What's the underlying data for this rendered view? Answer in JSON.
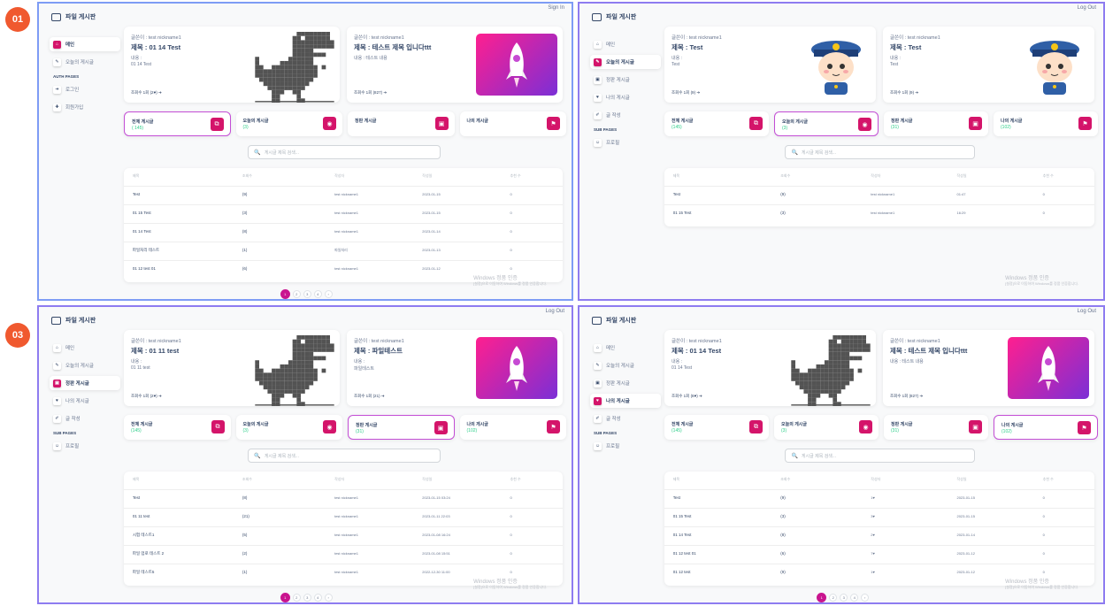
{
  "badges": [
    "01",
    "03"
  ],
  "app": {
    "brand": "파일 게시판"
  },
  "account": {
    "sign_in": "Sign In",
    "log_out": "Log Out"
  },
  "sidebar_guest": {
    "items": [
      "메인",
      "오늘의 게시글"
    ],
    "section": "AUTH PAGES",
    "auth_items": [
      "로그인",
      "회원가입"
    ]
  },
  "sidebar_user": {
    "items": [
      "메인",
      "오늘의 게시글",
      "정판 게시글",
      "나의 게시글",
      "글 작성"
    ],
    "section": "SUB PAGES",
    "profile": "프로필"
  },
  "panels": [
    {
      "left_post": {
        "author": "글쓴이 : test nickname1",
        "title": "제목 : 01 14 Test",
        "label": "내용 :",
        "content": "01 14 Test",
        "views": "조회수 1회 (2♥) ➔"
      },
      "right_post": {
        "author": "글쓴이 : test nickname1",
        "title": "제목 : 테스트 제목 입니다ttt",
        "label": "내용 : 테스트 내용",
        "content": "",
        "views": "조회수 1회 (827) ➔"
      },
      "stats": [
        {
          "label": "전체 게시글",
          "count": "( 145)"
        },
        {
          "label": "오늘의 게시글",
          "count": "(3)"
        },
        {
          "label": "정판 게시글",
          "count": ""
        },
        {
          "label": "나의 게시글",
          "count": ""
        }
      ],
      "search_placeholder": "게시글 제목 검색...",
      "headers": [
        "제목",
        "조회수",
        "작성자",
        "작성일",
        "추천 수"
      ],
      "rows": [
        [
          "Test",
          "(9)",
          "test nickname1",
          "2023-01-15",
          "0"
        ],
        [
          "01 15 Test",
          "(3)",
          "test nickname1",
          "2023-01-15",
          "0"
        ],
        [
          "01 14 Test",
          "(8)",
          "test nickname1",
          "2023-01-14",
          "0"
        ],
        [
          "파일처리 테스트",
          "(1)",
          "파일처리",
          "2023-01-13",
          "0"
        ],
        [
          "01 12 test 01",
          "(6)",
          "test nickname1",
          "2023-01-12",
          "0"
        ]
      ],
      "pages": [
        "1",
        "2",
        "3",
        "4",
        "›"
      ]
    },
    {
      "left_post": {
        "author": "글쓴이 : test nickname1",
        "title": "제목 : Test",
        "label": "내용 :",
        "content": "Test",
        "views": "조회수 1회 (9) ➔"
      },
      "right_post": {
        "author": "글쓴이 : test nickname1",
        "title": "제목 : Test",
        "label": "내용 :",
        "content": "Test",
        "views": "조회수 1회 (9) ➔"
      },
      "stats": [
        {
          "label": "전체 게시글",
          "count": "(145)"
        },
        {
          "label": "오늘의 게시글",
          "count": "(3)"
        },
        {
          "label": "정판 게시글",
          "count": "(31)"
        },
        {
          "label": "나의 게시글",
          "count": "(102)"
        }
      ],
      "search_placeholder": "게시글 제목 검색...",
      "headers": [
        "제목",
        "조회수",
        "작성자",
        "작성일",
        "추천 수"
      ],
      "rows": [
        [
          "Test",
          "(9)",
          "test nickname1",
          "01:47",
          "0"
        ],
        [
          "01 15 Test",
          "(3)",
          "test nickname1",
          "16:29",
          "0"
        ]
      ],
      "pages": []
    },
    {
      "left_post": {
        "author": "글쓴이 : test nickname1",
        "title": "제목 : 01 11 test",
        "label": "내용 :",
        "content": "01 11 test",
        "views": "조회수 1회 (2♥) ➔"
      },
      "right_post": {
        "author": "글쓴이 : test nickname1",
        "title": "제목 : 파일테스트",
        "label": "내용 :",
        "content": "파일테스트",
        "views": "조회수 1회 (21) ➔"
      },
      "stats": [
        {
          "label": "전체 게시글",
          "count": "(145)"
        },
        {
          "label": "오늘의 게시글",
          "count": "(3)"
        },
        {
          "label": "정판 게시글",
          "count": "(31)"
        },
        {
          "label": "나의 게시글",
          "count": "(102)"
        }
      ],
      "search_placeholder": "게시글 제목 검색...",
      "headers": [
        "제목",
        "조회수",
        "작성자",
        "작성일",
        "추천 수"
      ],
      "rows": [
        [
          "Test",
          "(8)",
          "test nickname1",
          "2023-01-15 03:24",
          "0"
        ],
        [
          "01 11 test",
          "(21)",
          "test nickname1",
          "2023-01-11 22:03",
          "0"
        ],
        [
          "시험 테스트1",
          "(5)",
          "test nickname1",
          "2023-01-08 16:24",
          "0"
        ],
        [
          "파일 업로 테스트 2",
          "(2)",
          "test nickname1",
          "2023-01-08 15:51",
          "0"
        ],
        [
          "파일 테스트5",
          "(1)",
          "test nickname1",
          "2022-12-30 11:00",
          "0"
        ]
      ],
      "pages": [
        "1",
        "2",
        "3",
        "4",
        "›"
      ]
    },
    {
      "left_post": {
        "author": "글쓴이 : test nickname1",
        "title": "제목 : 01 14 Test",
        "label": "내용 :",
        "content": "01 14 Test",
        "views": "조회수 1회 (8♥) ➔"
      },
      "right_post": {
        "author": "글쓴이 : test nickname1",
        "title": "제목 : 테스트 제목 입니다ttt",
        "label": "내용 : 테스트 내용",
        "content": "",
        "views": "조회수 1회 (827) ➔"
      },
      "stats": [
        {
          "label": "전체 게시글",
          "count": "(145)"
        },
        {
          "label": "오늘의 게시글",
          "count": "(3)"
        },
        {
          "label": "정판 게시글",
          "count": "(31)"
        },
        {
          "label": "나의 게시글",
          "count": "(102)"
        }
      ],
      "search_placeholder": "게시글 제목 검색...",
      "headers": [
        "제목",
        "조회수",
        "작성자",
        "작성일",
        "추천 수"
      ],
      "rows": [
        [
          "Test",
          "(9)",
          "1♥",
          "2023-01-15",
          "0"
        ],
        [
          "01 15 Test",
          "(3)",
          "3♥",
          "2023-01-15",
          "0"
        ],
        [
          "01 14 Test",
          "(8)",
          "2♥",
          "2023-01-14",
          "0"
        ],
        [
          "01 12 test 01",
          "(6)",
          "7♥",
          "2023-01-12",
          "0"
        ],
        [
          "01 12 test",
          "(9)",
          "1♥",
          "2023-01-12",
          "0"
        ]
      ],
      "pages": [
        "1",
        "2",
        "3",
        "4",
        "›"
      ]
    }
  ],
  "watermark": {
    "title": "Windows 정품 인증",
    "sub": "[설정]으로 이동하여 Windows를 정품 인증합니다."
  },
  "colors": {
    "accent": "#d4146a",
    "panel_border": "#8e7cf0",
    "badge": "#f0592f",
    "highlight": "#c34ed5"
  }
}
